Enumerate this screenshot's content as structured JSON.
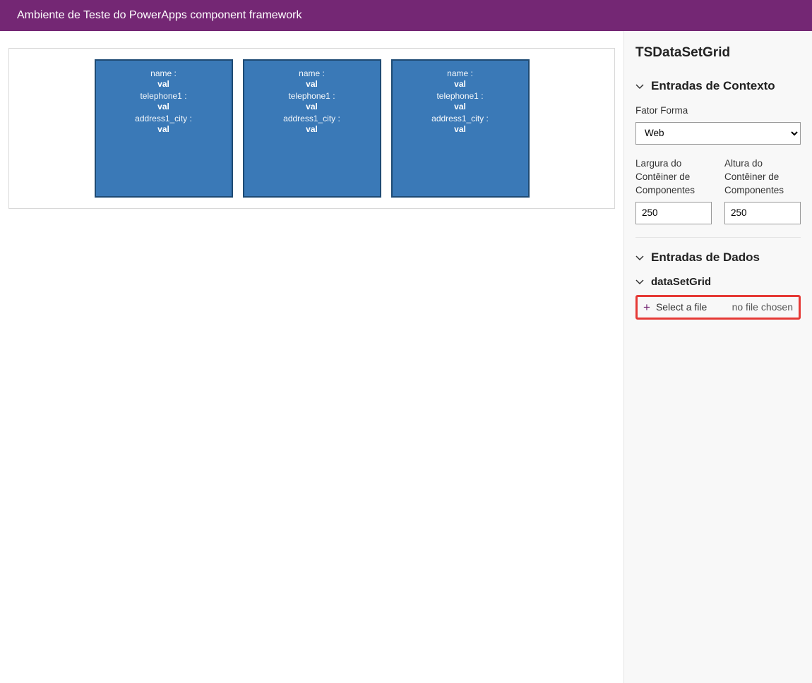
{
  "header": {
    "title": "Ambiente de Teste do PowerApps component framework"
  },
  "canvas": {
    "cards": [
      {
        "fields": [
          {
            "label": "name :",
            "value": "val"
          },
          {
            "label": "telephone1 :",
            "value": "val"
          },
          {
            "label": "address1_city :",
            "value": "val"
          }
        ]
      },
      {
        "fields": [
          {
            "label": "name :",
            "value": "val"
          },
          {
            "label": "telephone1 :",
            "value": "val"
          },
          {
            "label": "address1_city :",
            "value": "val"
          }
        ]
      },
      {
        "fields": [
          {
            "label": "name :",
            "value": "val"
          },
          {
            "label": "telephone1 :",
            "value": "val"
          },
          {
            "label": "address1_city :",
            "value": "val"
          }
        ]
      }
    ]
  },
  "panel": {
    "title": "TSDataSetGrid",
    "context": {
      "heading": "Entradas de Contexto",
      "formFactor": {
        "label": "Fator Forma",
        "value": "Web",
        "options": [
          "Web"
        ]
      },
      "width": {
        "label": "Largura do Contêiner de Componentes",
        "value": "250"
      },
      "height": {
        "label": "Altura do Contêiner de Componentes",
        "value": "250"
      }
    },
    "data": {
      "heading": "Entradas de Dados",
      "subheading": "dataSetGrid",
      "file": {
        "selectLabel": "Select a file",
        "chosenLabel": "no file chosen"
      }
    }
  }
}
